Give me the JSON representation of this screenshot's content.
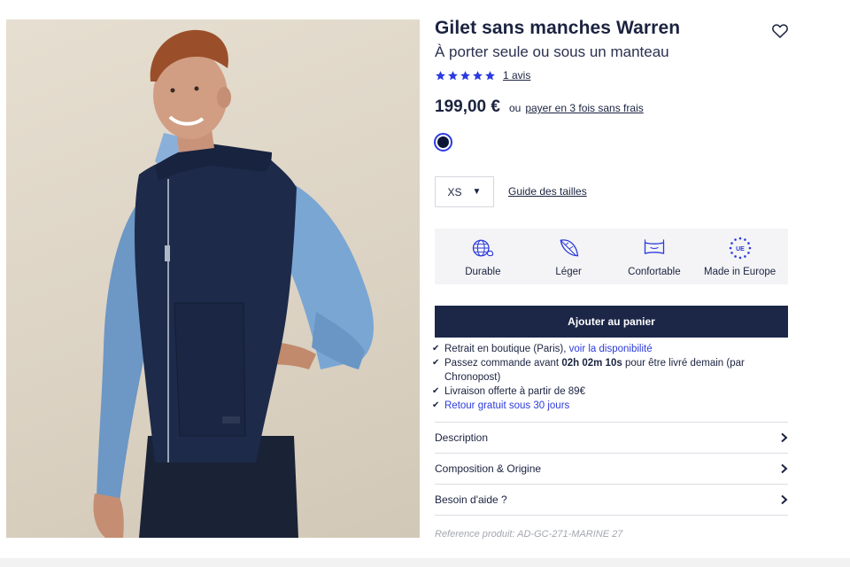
{
  "product": {
    "title": "Gilet sans manches Warren",
    "subtitle": "À porter seule ou sous un manteau",
    "rating": {
      "stars": 5,
      "max_stars": 5,
      "reviews_label": "1 avis"
    },
    "price": "199,00 €",
    "price_or": "ou",
    "installment_label": "payer en 3 fois sans frais",
    "swatch_color": "#0c1536",
    "size": {
      "selected": "XS",
      "guide_label": "Guide des tailles"
    },
    "wishlist_icon": "heart-icon"
  },
  "features": [
    {
      "label": "Durable",
      "icon": "globe-leaf-icon"
    },
    {
      "label": "Léger",
      "icon": "feather-icon"
    },
    {
      "label": "Confortable",
      "icon": "cushion-icon"
    },
    {
      "label": "Made in Europe",
      "icon": "eu-stars-icon"
    }
  ],
  "cta": {
    "add_to_cart": "Ajouter au panier"
  },
  "perks": {
    "pickup": {
      "text": "Retrait en boutique (Paris),",
      "link": "voir la disponibilité"
    },
    "delivery": {
      "before": "Passez commande avant",
      "countdown": "02h 02m 10s",
      "after": "pour être livré demain (par Chronopost)"
    },
    "free_shipping": {
      "text": "Livraison offerte à partir de 89€"
    },
    "returns": {
      "link": "Retour gratuit sous 30 jours"
    }
  },
  "accordion": [
    {
      "label": "Description"
    },
    {
      "label": "Composition & Origine"
    },
    {
      "label": "Besoin d'aide ?"
    }
  ],
  "reference": "Reference produit: AD-GC-271-MARINE 27",
  "colors": {
    "navy": "#1b2340",
    "button": "#1c2748",
    "link_blue": "#2c3bdc",
    "star_blue": "#2b3ae0",
    "feature_bg": "#f4f4f6"
  }
}
